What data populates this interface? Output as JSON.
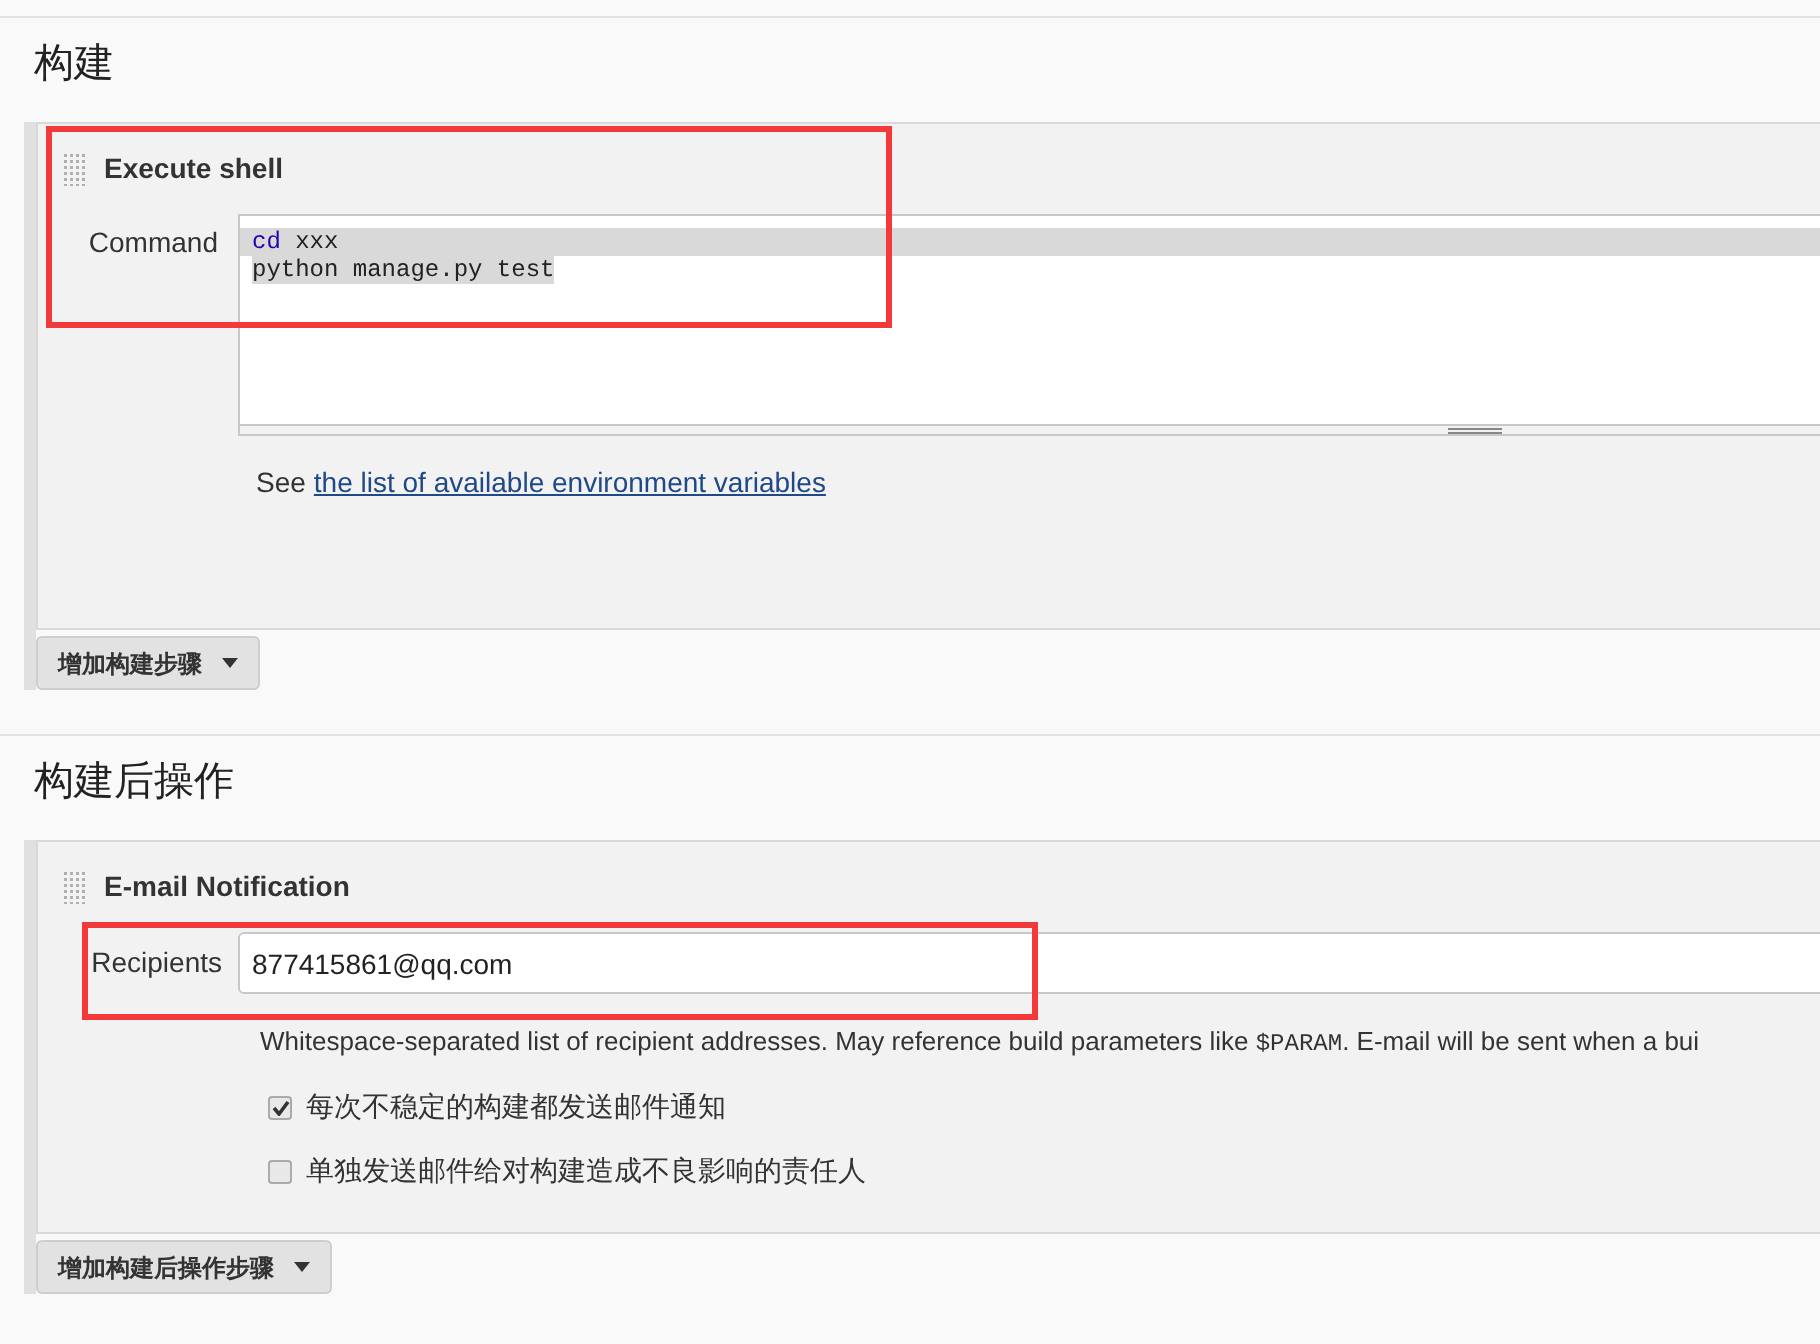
{
  "sections": [
    {
      "heading": "构建",
      "step": {
        "title": "Execute shell",
        "highlighted": true,
        "field_label": "Command",
        "code_lines": [
          {
            "current": true,
            "tokens": [
              {
                "kind": "keyword",
                "text": "cd"
              },
              {
                "kind": "plain",
                "text": " xxx"
              }
            ]
          },
          {
            "current": false,
            "tokens": [
              {
                "kind": "plain",
                "text": "python manage.py test"
              }
            ]
          }
        ],
        "help_prefix": "See",
        "help_link": "the list of available environment variables"
      },
      "add_button": "增加构建步骤"
    },
    {
      "heading": "构建后操作",
      "step": {
        "title": "E-mail Notification",
        "highlighted": true,
        "field_label": "Recipients",
        "value": "877415861@qq.com",
        "help": {
          "before": "Whitespace-separated list of recipient addresses. May reference build parameters like ",
          "code": "$PARAM",
          "after": ". E-mail will be sent when a bui"
        },
        "options": [
          {
            "label": "每次不稳定的构建都发送邮件通知",
            "checked": true
          },
          {
            "label": "单独发送邮件给对构建造成不良影响的责任人",
            "checked": false
          }
        ]
      },
      "add_button": "增加构建后操作步骤"
    }
  ]
}
